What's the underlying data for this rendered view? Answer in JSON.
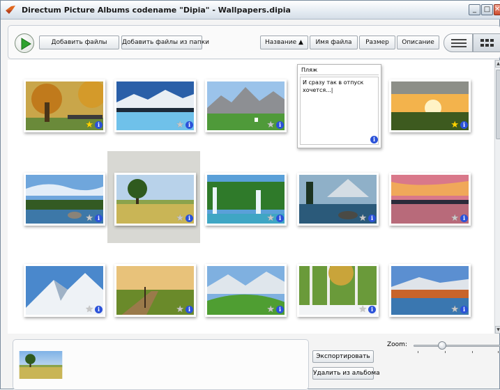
{
  "window": {
    "title": "Directum Picture Albums codename \"Dipia\" - Wallpapers.dipia",
    "controls": {
      "minimize": "_",
      "maximize": "□",
      "close": "✕"
    }
  },
  "toolbar": {
    "add_files": "Добавить файлы",
    "add_folder": "Добавить файлы из папки",
    "sort_name": "Название ▲",
    "sort_filename": "Имя файла",
    "sort_size": "Размер",
    "sort_description": "Описание"
  },
  "note": {
    "title": "Пляж",
    "text": "И сразу так в отпуск хочется...|"
  },
  "thumbnails": [
    {
      "scene": "autumn-park",
      "rated": true
    },
    {
      "scene": "snow-mountain-lake",
      "rated": false
    },
    {
      "scene": "alpine-village",
      "rated": false
    },
    {
      "scene": "sunset-meadow",
      "rated": true
    },
    {
      "scene": "rocky-lake",
      "rated": false
    },
    {
      "scene": "tree-field",
      "rated": false
    },
    {
      "scene": "waterfall",
      "rated": false
    },
    {
      "scene": "mountain-lake-rocks",
      "rated": false
    },
    {
      "scene": "pink-sunset-lake",
      "rated": false
    },
    {
      "scene": "snowy-peaks",
      "rated": false
    },
    {
      "scene": "country-road",
      "rated": false
    },
    {
      "scene": "green-hills-mountains",
      "rated": false
    },
    {
      "scene": "birch-forest",
      "rated": false
    },
    {
      "scene": "autumn-lake",
      "rated": false
    },
    {
      "scene": "snowy-peak-blue",
      "rated": false
    }
  ],
  "bottom": {
    "export": "Экспортировать",
    "remove": "Удалить из альбома",
    "zoom_label": "Zoom:",
    "zoom_level": 0.35
  },
  "colors": {
    "star_rated": "#ffd400",
    "star_unrated": "#c8c8c8",
    "info": "#2b52d9",
    "selection": "#d8d8d3"
  }
}
